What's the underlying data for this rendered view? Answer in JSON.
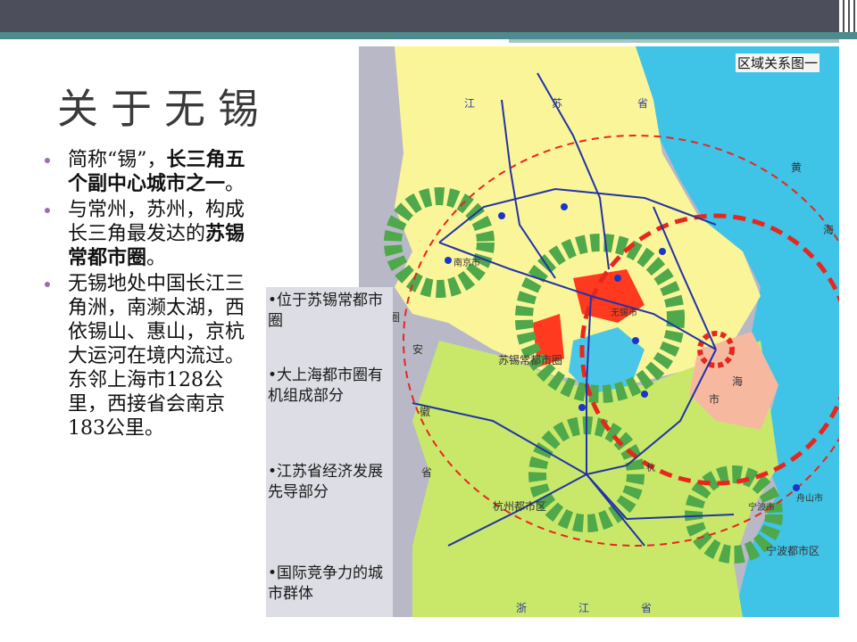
{
  "slide": {
    "title": "关于无锡",
    "bullets": [
      {
        "pre": "简称“锡”，",
        "bold": "长三角五个副中心城市之一",
        "post": "。"
      },
      {
        "pre": "与常州，苏州，构成长三角最发达的",
        "bold": "苏锡常都市圈",
        "post": "。"
      },
      {
        "pre": "无锡地处中国长江三角洲，南濒太湖，西依锡山、惠山，京杭大运河在境内流过。东邻上海市128公里，西接省会南京183公里。",
        "bold": "",
        "post": ""
      }
    ],
    "side_notes": [
      "•位于苏锡常都市圈",
      "•大上海都市圈有机组成部分",
      "•江苏省经济发展先导部分",
      "•国际竞争力的城市群体"
    ]
  },
  "map": {
    "caption": "区域关系图一",
    "labels": {
      "jiangsu_1": "江",
      "jiangsu_2": "苏",
      "jiangsu_3": "省",
      "huang": "黄",
      "hai": "海",
      "an": "安",
      "hui": "徽",
      "sheng": "省",
      "dushiquan": "都市圈",
      "nanjing": "南京市",
      "suxichang": "苏锡常都市圈",
      "shanghai_1": "海",
      "shanghai_2": "市",
      "hangzhou": "杭州都市区",
      "ningbo": "宁波都市区",
      "ningbo_city": "宁波市",
      "zhoushan": "舟山市",
      "wuxi": "无锡市",
      "hang": "杭",
      "zhe": "浙",
      "jiang_s": "江",
      "sheng_s": "省"
    },
    "colors": {
      "sea": "#3fc3e6",
      "jiangsu_land": "#fbf59a",
      "south_land": "#c9e86a",
      "urban_red": "#ff3a1f",
      "ring_green": "#4fa84a",
      "road_blue": "#2133a6",
      "shanghai_pink": "#f6b9a0"
    }
  }
}
